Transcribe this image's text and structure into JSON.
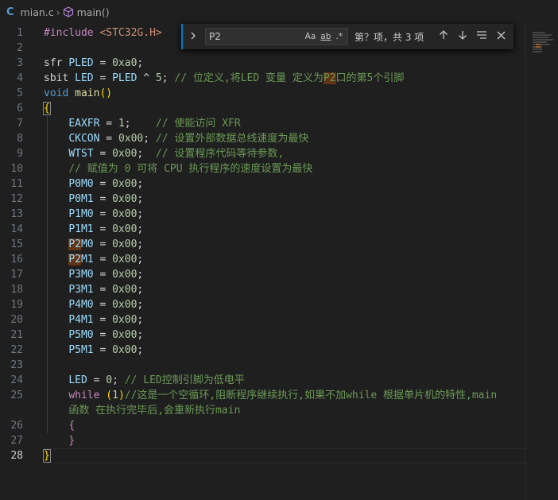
{
  "breadcrumb": {
    "lang_icon": "C",
    "file": "mian.c",
    "symbol": "main()"
  },
  "find": {
    "toggle_icon": "chevron-right-icon",
    "query": "P2",
    "opt_case": "Aa",
    "opt_word": "ab",
    "opt_regex": ".*",
    "result": "第？项，共 3 项",
    "prev_icon": "arrow-up-icon",
    "next_icon": "arrow-down-icon",
    "selection_icon": "lines-icon",
    "close_icon": "close-icon"
  },
  "lines": [
    {
      "n": "1",
      "parts": [
        [
          "pp",
          "#include "
        ],
        [
          "str",
          "<STC32G.H>"
        ]
      ]
    },
    {
      "n": "2",
      "parts": []
    },
    {
      "n": "3",
      "parts": [
        [
          "pl",
          "sfr "
        ],
        [
          "id",
          "PLED"
        ],
        [
          "pl",
          " = "
        ],
        [
          "num",
          "0xa0"
        ],
        [
          "pl",
          ";"
        ]
      ]
    },
    {
      "n": "4",
      "parts": [
        [
          "pl",
          "sbit "
        ],
        [
          "id",
          "LED"
        ],
        [
          "pl",
          " = "
        ],
        [
          "id",
          "PLED"
        ],
        [
          "pl",
          " ^ "
        ],
        [
          "num",
          "5"
        ],
        [
          "pl",
          "; "
        ],
        [
          "cm",
          "// 位定义,将LED 变量 定义为"
        ],
        [
          "cmhl",
          "P2"
        ],
        [
          "cm",
          "口的第5个引脚"
        ]
      ]
    },
    {
      "n": "5",
      "parts": [
        [
          "kw",
          "void "
        ],
        [
          "fn",
          "main"
        ],
        [
          "brace-y",
          "()"
        ]
      ]
    },
    {
      "n": "6",
      "parts": [
        [
          "brace-box",
          "{"
        ]
      ]
    },
    {
      "n": "7",
      "parts": [
        [
          "pl",
          "    "
        ],
        [
          "id",
          "EAXFR"
        ],
        [
          "pl",
          " = "
        ],
        [
          "num",
          "1"
        ],
        [
          "pl",
          ";    "
        ],
        [
          "cm",
          "// 使能访问 XFR"
        ]
      ]
    },
    {
      "n": "8",
      "parts": [
        [
          "pl",
          "    "
        ],
        [
          "id",
          "CKCON"
        ],
        [
          "pl",
          " = "
        ],
        [
          "num",
          "0x00"
        ],
        [
          "pl",
          "; "
        ],
        [
          "cm",
          "// 设置外部数据总线速度为最快"
        ]
      ]
    },
    {
      "n": "9",
      "parts": [
        [
          "pl",
          "    "
        ],
        [
          "id",
          "WTST"
        ],
        [
          "pl",
          " = "
        ],
        [
          "num",
          "0x00"
        ],
        [
          "pl",
          ";  "
        ],
        [
          "cm",
          "// 设置程序代码等待参数,"
        ]
      ]
    },
    {
      "n": "10",
      "parts": [
        [
          "pl",
          "    "
        ],
        [
          "cm",
          "// 赋值为 0 可将 CPU 执行程序的速度设置为最快"
        ]
      ]
    },
    {
      "n": "11",
      "parts": [
        [
          "pl",
          "    "
        ],
        [
          "id",
          "P0M0"
        ],
        [
          "pl",
          " = "
        ],
        [
          "num",
          "0x00"
        ],
        [
          "pl",
          ";"
        ]
      ]
    },
    {
      "n": "12",
      "parts": [
        [
          "pl",
          "    "
        ],
        [
          "id",
          "P0M1"
        ],
        [
          "pl",
          " = "
        ],
        [
          "num",
          "0x00"
        ],
        [
          "pl",
          ";"
        ]
      ]
    },
    {
      "n": "13",
      "parts": [
        [
          "pl",
          "    "
        ],
        [
          "id",
          "P1M0"
        ],
        [
          "pl",
          " = "
        ],
        [
          "num",
          "0x00"
        ],
        [
          "pl",
          ";"
        ]
      ]
    },
    {
      "n": "14",
      "parts": [
        [
          "pl",
          "    "
        ],
        [
          "id",
          "P1M1"
        ],
        [
          "pl",
          " = "
        ],
        [
          "num",
          "0x00"
        ],
        [
          "pl",
          ";"
        ]
      ]
    },
    {
      "n": "15",
      "parts": [
        [
          "pl",
          "    "
        ],
        [
          "idhl",
          "P2"
        ],
        [
          "id",
          "M0"
        ],
        [
          "pl",
          " = "
        ],
        [
          "num",
          "0x00"
        ],
        [
          "pl",
          ";"
        ]
      ]
    },
    {
      "n": "16",
      "parts": [
        [
          "pl",
          "    "
        ],
        [
          "idhl",
          "P2"
        ],
        [
          "id",
          "M1"
        ],
        [
          "pl",
          " = "
        ],
        [
          "num",
          "0x00"
        ],
        [
          "pl",
          ";"
        ]
      ]
    },
    {
      "n": "17",
      "parts": [
        [
          "pl",
          "    "
        ],
        [
          "id",
          "P3M0"
        ],
        [
          "pl",
          " = "
        ],
        [
          "num",
          "0x00"
        ],
        [
          "pl",
          ";"
        ]
      ]
    },
    {
      "n": "18",
      "parts": [
        [
          "pl",
          "    "
        ],
        [
          "id",
          "P3M1"
        ],
        [
          "pl",
          " = "
        ],
        [
          "num",
          "0x00"
        ],
        [
          "pl",
          ";"
        ]
      ]
    },
    {
      "n": "19",
      "parts": [
        [
          "pl",
          "    "
        ],
        [
          "id",
          "P4M0"
        ],
        [
          "pl",
          " = "
        ],
        [
          "num",
          "0x00"
        ],
        [
          "pl",
          ";"
        ]
      ]
    },
    {
      "n": "20",
      "parts": [
        [
          "pl",
          "    "
        ],
        [
          "id",
          "P4M1"
        ],
        [
          "pl",
          " = "
        ],
        [
          "num",
          "0x00"
        ],
        [
          "pl",
          ";"
        ]
      ]
    },
    {
      "n": "21",
      "parts": [
        [
          "pl",
          "    "
        ],
        [
          "id",
          "P5M0"
        ],
        [
          "pl",
          " = "
        ],
        [
          "num",
          "0x00"
        ],
        [
          "pl",
          ";"
        ]
      ]
    },
    {
      "n": "22",
      "parts": [
        [
          "pl",
          "    "
        ],
        [
          "id",
          "P5M1"
        ],
        [
          "pl",
          " = "
        ],
        [
          "num",
          "0x00"
        ],
        [
          "pl",
          ";"
        ]
      ]
    },
    {
      "n": "23",
      "parts": []
    },
    {
      "n": "24",
      "parts": [
        [
          "pl",
          "    "
        ],
        [
          "id",
          "LED"
        ],
        [
          "pl",
          " = "
        ],
        [
          "num",
          "0"
        ],
        [
          "pl",
          "; "
        ],
        [
          "cm",
          "// LED控制引脚为低电平"
        ]
      ]
    },
    {
      "n": "25",
      "parts": [
        [
          "pl",
          "    "
        ],
        [
          "pp",
          "while "
        ],
        [
          "brace-y",
          "("
        ],
        [
          "num",
          "1"
        ],
        [
          "brace-y",
          ")"
        ],
        [
          "cm",
          "//这是一个空循环,阻断程序继续执行,如果不加while 根据单片机的特性,main"
        ]
      ]
    },
    {
      "n": "",
      "parts": [
        [
          "pl",
          "    "
        ],
        [
          "cm",
          "函数 在执行完毕后,会重新执行main"
        ]
      ]
    },
    {
      "n": "26",
      "parts": [
        [
          "pl",
          "    "
        ],
        [
          "brace-p",
          "{"
        ]
      ]
    },
    {
      "n": "27",
      "parts": [
        [
          "pl",
          "    "
        ],
        [
          "brace-p",
          "}"
        ]
      ]
    },
    {
      "n": "28",
      "parts": [
        [
          "brace-box",
          "}"
        ]
      ],
      "active": true
    }
  ]
}
